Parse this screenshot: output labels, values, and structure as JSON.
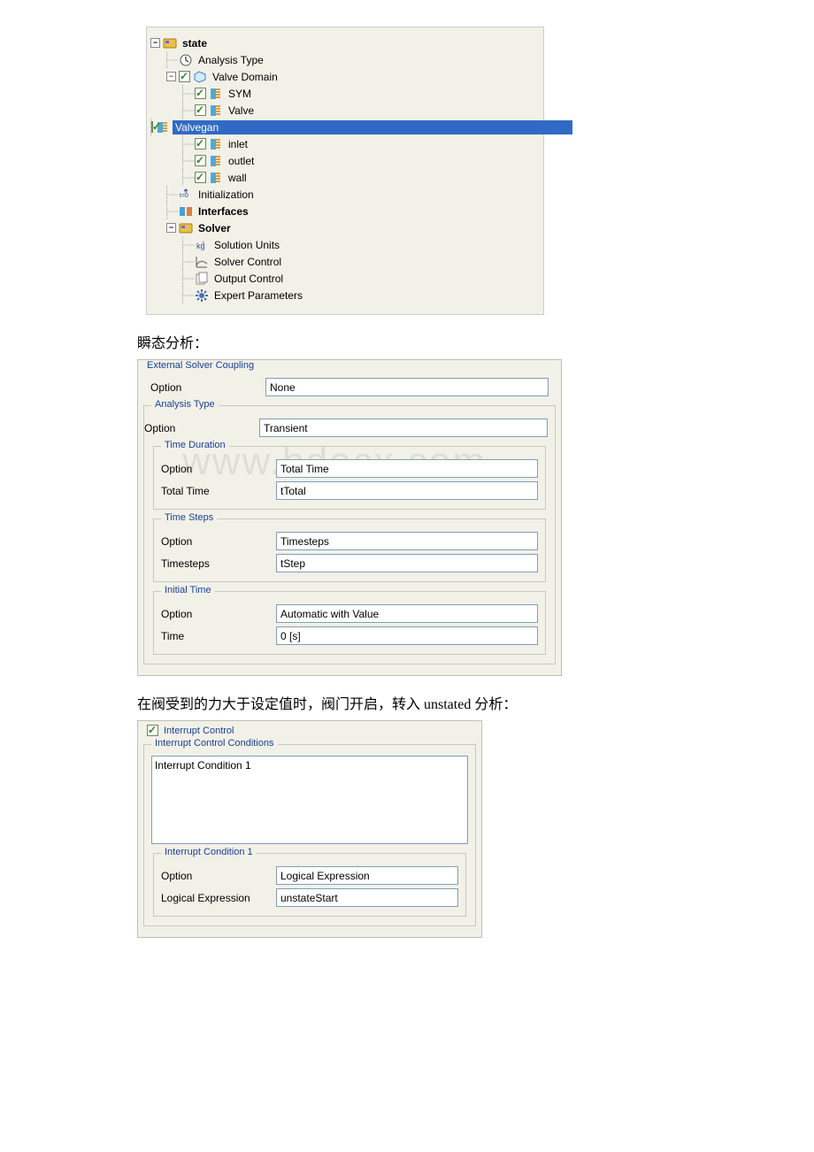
{
  "tree": {
    "root": "state",
    "analysis_type": "Analysis Type",
    "valve_domain": "Valve Domain",
    "children": {
      "sym": "SYM",
      "valve": "Valve",
      "valvegan": "Valvegan",
      "inlet": "inlet",
      "outlet": "outlet",
      "wall": "wall"
    },
    "initialization": "Initialization",
    "interfaces": "Interfaces",
    "solver": "Solver",
    "solver_children": {
      "units": "Solution Units",
      "control": "Solver Control",
      "output": "Output Control",
      "expert": "Expert Parameters"
    }
  },
  "caption1": "瞬态分析：",
  "caption2": "在阀受到的力大于设定值时，阀门开启，转入 unstated 分析：",
  "form1": {
    "ext_coupling_legend": "External Solver Coupling",
    "ext_coupling_option_label": "Option",
    "ext_coupling_option_value": "None",
    "analysis_type_legend": "Analysis Type",
    "analysis_type_option_label": "Option",
    "analysis_type_option_value": "Transient",
    "time_duration_legend": "Time Duration",
    "time_duration_option_label": "Option",
    "time_duration_option_value": "Total Time",
    "total_time_label": "Total Time",
    "total_time_value": "tTotal",
    "time_steps_legend": "Time Steps",
    "time_steps_option_label": "Option",
    "time_steps_option_value": "Timesteps",
    "timesteps_label": "Timesteps",
    "timesteps_value": "tStep",
    "initial_time_legend": "Initial Time",
    "initial_time_option_label": "Option",
    "initial_time_option_value": "Automatic with Value",
    "time_label": "Time",
    "time_value": "0 [s]"
  },
  "form2": {
    "interrupt_control": "Interrupt Control",
    "icc_legend": "Interrupt Control Conditions",
    "list_item": "Interrupt Condition 1",
    "ic1_legend": "Interrupt Condition 1",
    "option_label": "Option",
    "option_value": "Logical Expression",
    "le_label": "Logical Expression",
    "le_value": "unstateStart"
  },
  "watermark": "www.bdocx.com"
}
